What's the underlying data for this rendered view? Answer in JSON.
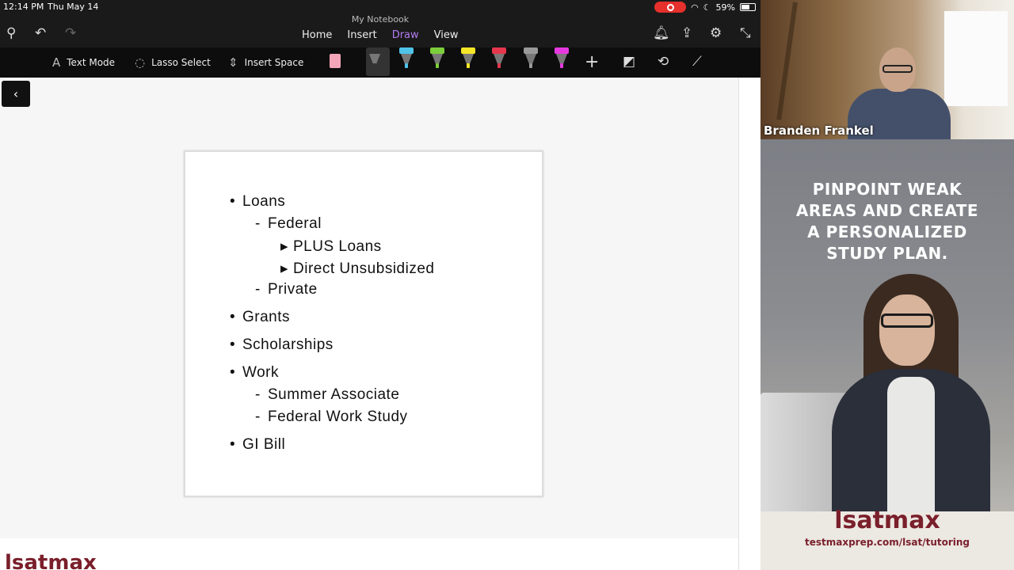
{
  "status_bar": {
    "time": "12:14 PM",
    "date": "Thu May 14",
    "battery": "59%"
  },
  "notebook": {
    "title": "My Notebook"
  },
  "ribbon_tabs": [
    {
      "label": "Home"
    },
    {
      "label": "Insert"
    },
    {
      "label": "Draw",
      "active": true
    },
    {
      "label": "View"
    }
  ],
  "draw_tools": {
    "text_mode": "Text Mode",
    "lasso_select": "Lasso Select",
    "insert_space": "Insert Space"
  },
  "pens": [
    {
      "name": "eraser",
      "color": "#f2a6b8"
    },
    {
      "name": "black-pen",
      "color": "#333333"
    },
    {
      "name": "cyan-pen",
      "color": "#4fc3e8"
    },
    {
      "name": "green-pen",
      "color": "#7ccf3a"
    },
    {
      "name": "yellow-highlighter",
      "color": "#f5e628"
    },
    {
      "name": "red-pen",
      "color": "#e5364d"
    },
    {
      "name": "gray-pen",
      "color": "#9a9a9a"
    },
    {
      "name": "magenta-highlighter",
      "color": "#e63ae0"
    }
  ],
  "slide": {
    "items": [
      {
        "level": 1,
        "marker": "•",
        "text": "Loans"
      },
      {
        "level": 2,
        "marker": "-",
        "text": "Federal"
      },
      {
        "level": 3,
        "marker": "▸",
        "text": "PLUS Loans"
      },
      {
        "level": 3,
        "marker": "▸",
        "text": "Direct Unsubsidized"
      },
      {
        "level": 2,
        "marker": "-",
        "text": "Private"
      },
      {
        "level": 1,
        "marker": "•",
        "text": "Grants"
      },
      {
        "level": 1,
        "marker": "•",
        "text": "Scholarships"
      },
      {
        "level": 1,
        "marker": "•",
        "text": "Work"
      },
      {
        "level": 2,
        "marker": "-",
        "text": "Summer Associate"
      },
      {
        "level": 2,
        "marker": "-",
        "text": "Federal Work Study"
      },
      {
        "level": 1,
        "marker": "•",
        "text": "GI Bill"
      }
    ]
  },
  "footer": {
    "logo": "lsatmax"
  },
  "webcam": {
    "name": "Branden Frankel"
  },
  "ad": {
    "headline_lines": [
      "PINPOINT WEAK",
      "AREAS AND CREATE",
      "A PERSONALIZED",
      "STUDY PLAN."
    ],
    "logo": "lsatmax",
    "url": "testmaxprep.com/lsat/tutoring"
  }
}
